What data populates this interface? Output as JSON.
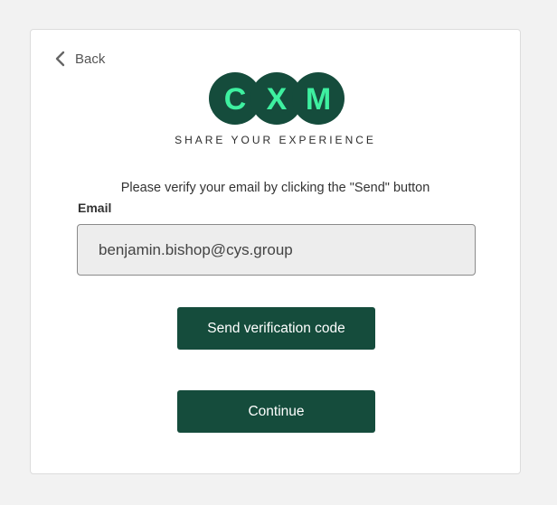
{
  "back": {
    "label": "Back"
  },
  "logo": {
    "letters": [
      "C",
      "X",
      "M"
    ],
    "circle_color": "#154c3c",
    "letter_color": "#3ef0a0"
  },
  "tagline": "SHARE YOUR EXPERIENCE",
  "instruction": "Please verify your email by clicking the \"Send\" button",
  "email": {
    "label": "Email",
    "value": "benjamin.bishop@cys.group"
  },
  "buttons": {
    "send": "Send verification code",
    "continue": "Continue"
  },
  "colors": {
    "primary": "#154c3c",
    "background": "#f2f2f2"
  }
}
